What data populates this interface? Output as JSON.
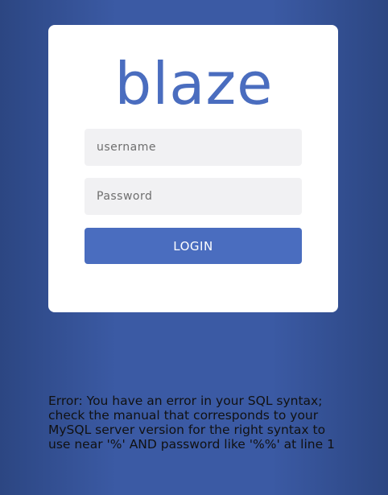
{
  "login": {
    "logo_text": "blaze",
    "username_placeholder": "username",
    "password_placeholder": "Password",
    "button_label": "LOGIN"
  },
  "error": {
    "message": "Error: You have an error in your SQL syntax; check the manual that corresponds to your MySQL server version for the right syntax to use near '%' AND password like '%%' at line 1"
  },
  "colors": {
    "accent": "#4a6dbf",
    "background": "#3b5aa4",
    "field_bg": "#f1f1f3",
    "card_bg": "#ffffff"
  }
}
